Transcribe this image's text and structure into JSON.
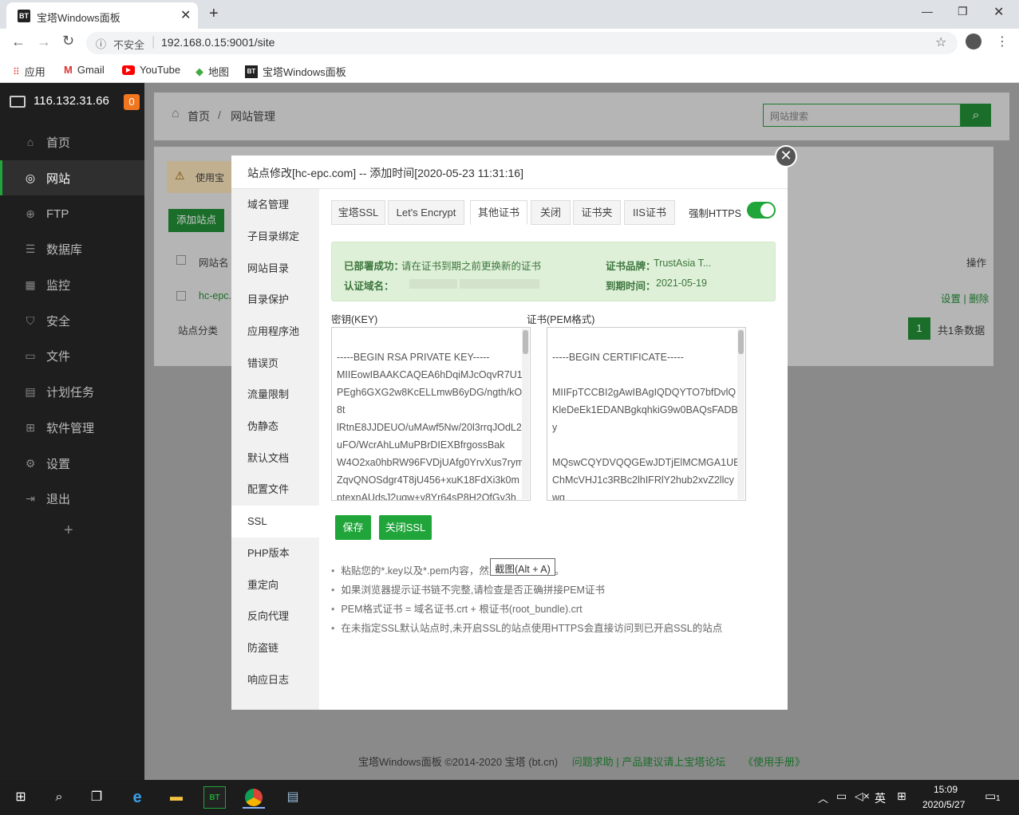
{
  "browser": {
    "tab_title": "宝塔Windows面板",
    "security_label": "不安全",
    "url": "192.168.0.15:9001/site",
    "bookmarks": [
      "应用",
      "Gmail",
      "YouTube",
      "地图",
      "宝塔Windows面板"
    ]
  },
  "sidebar": {
    "server": "116.132.31.66",
    "badge": "0",
    "items": [
      "首页",
      "网站",
      "FTP",
      "数据库",
      "监控",
      "安全",
      "文件",
      "计划任务",
      "软件管理",
      "设置",
      "退出"
    ],
    "add": "+"
  },
  "header": {
    "home": "首页",
    "sep": "/",
    "current": "网站管理",
    "search_placeholder": "网站搜索"
  },
  "bg": {
    "warn": "使用宝",
    "add_site": "添加站点",
    "col_name": "网站名",
    "row_name": "hc-epc.",
    "op": "操作",
    "row_ops": "设置 | 删除",
    "category": "站点分类",
    "page": "1",
    "total": "共1条数据"
  },
  "modal": {
    "title": "站点修改[hc-epc.com] -- 添加时间[2020-05-23 11:31:16]",
    "left_menu": [
      "域名管理",
      "子目录绑定",
      "网站目录",
      "目录保护",
      "应用程序池",
      "错误页",
      "流量限制",
      "伪静态",
      "默认文档",
      "配置文件",
      "SSL",
      "PHP版本",
      "重定向",
      "反向代理",
      "防盗链",
      "响应日志"
    ],
    "tabs": [
      "宝塔SSL",
      "Let's Encrypt",
      "其他证书",
      "关闭",
      "证书夹",
      "IIS证书"
    ],
    "force_https": "强制HTTPS",
    "alert": {
      "deployed_label": "已部署成功：",
      "deployed_text": "请在证书到期之前更换新的证书",
      "domain_label": "认证域名：",
      "brand_label": "证书品牌：",
      "brand": "TrustAsia T...",
      "expire_label": "到期时间：",
      "expire": "2021-05-19"
    },
    "key_label": "密钥(KEY)",
    "cert_label": "证书(PEM格式)",
    "key_text": "-----BEGIN RSA PRIVATE KEY-----\nMIIEowIBAAKCAQEA6hDqiMJcOqvR7U1PEgh6GXG2w8KcELLmwB6yDG/ngth/kO8t\nlRtnE8JJDEUO/uMAwf5Nw/20l3rrqJOdL2uFO/WcrAhLuMuPBrDIEXBfrgossBak\nW4O2xa0hbRW96FVDjUAfg0YrvXus7rymZqvQNOSdgr4T8jU456+xuK18FdXi3k0m\nptexnAUdsJ2uqw+y8Yr64sP8H2QfGy3h",
    "cert_text": "-----BEGIN CERTIFICATE-----\n\nMIIFpTCCBI2gAwIBAgIQDQYTO7bfDvlQKleDeEk1EDANBgkqhkiG9w0BAQsFADBy\n\nMQswCQYDVQQGEwJDTjElMCMGA1UEChMcVHJ1c3RBc2lhIFRlY2hub2xvZ2llcywg",
    "save": "保存",
    "close_ssl": "关闭SSL",
    "tips": [
      "粘贴您的*.key以及*.pem内容，然",
      "如果浏览器提示证书链不完整,请检查是否正确拼接PEM证书",
      "PEM格式证书 = 域名证书.crt + 根证书(root_bundle).crt",
      "在未指定SSL默认站点时,未开启SSL的站点使用HTTPS会直接访问到已开启SSL的站点"
    ],
    "tip_tail": "。",
    "tooltip": "截图(Alt + A)"
  },
  "footer": {
    "copy": "宝塔Windows面板 ©2014-2020 宝塔 (bt.cn)",
    "links": "问题求助 | 产品建议请上宝塔论坛",
    "manual": "《使用手册》"
  },
  "taskbar": {
    "time": "15:09",
    "date": "2020/5/27",
    "ime": "英",
    "notify": "1"
  }
}
